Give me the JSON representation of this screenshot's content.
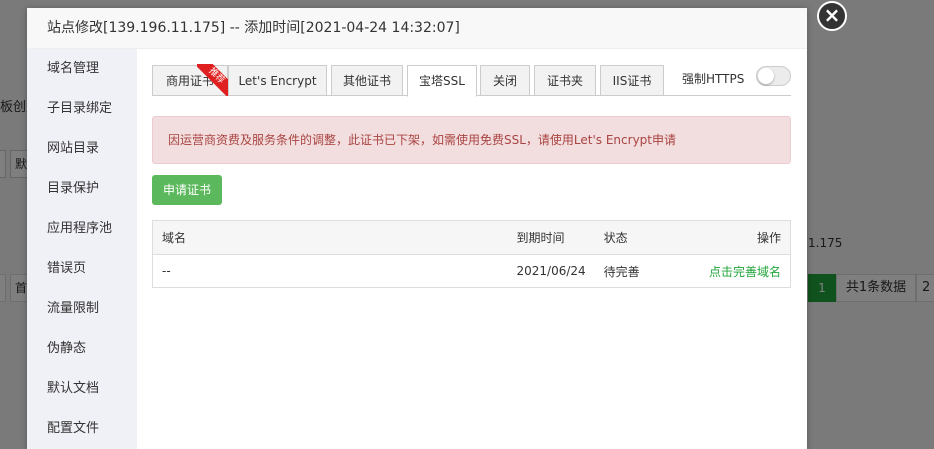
{
  "background": {
    "partial_text_1": "板创建",
    "partial_button": "默",
    "ip_suffix": "1.175",
    "pager_prev_partial": "首",
    "pager_current": "1",
    "pager_total": "共1条数据",
    "pager_next_partial": "2"
  },
  "modal": {
    "title": "站点修改[139.196.11.175] -- 添加时间[2021-04-24 14:32:07]",
    "close_glyph": "×"
  },
  "sidebar": {
    "items": [
      {
        "label": "域名管理"
      },
      {
        "label": "子目录绑定"
      },
      {
        "label": "网站目录"
      },
      {
        "label": "目录保护"
      },
      {
        "label": "应用程序池"
      },
      {
        "label": "错误页"
      },
      {
        "label": "流量限制"
      },
      {
        "label": "伪静态"
      },
      {
        "label": "默认文档"
      },
      {
        "label": "配置文件"
      }
    ]
  },
  "tabs": {
    "items": [
      {
        "label": "商用证书",
        "badge": "推荐"
      },
      {
        "label": "Let's Encrypt"
      },
      {
        "label": "其他证书"
      },
      {
        "label": "宝塔SSL"
      },
      {
        "label": "关闭"
      },
      {
        "label": "证书夹"
      },
      {
        "label": "IIS证书"
      }
    ],
    "active": "宝塔SSL",
    "force_https_label": "强制HTTPS",
    "force_https_on": false
  },
  "alert": {
    "text": "因运营商资费及服务条件的调整，此证书已下架，如需使用免费SSL，请使用Let's Encrypt申请"
  },
  "apply_button": "申请证书",
  "table": {
    "headers": {
      "domain": "域名",
      "expire": "到期时间",
      "status": "状态",
      "action": "操作"
    },
    "rows": [
      {
        "domain": "--",
        "expire": "2021/06/24",
        "status": "待完善",
        "action": "点击完善域名"
      }
    ]
  },
  "colors": {
    "accent_green": "#20a53a",
    "button_green": "#5cb85c",
    "alert_bg": "#f2dede",
    "alert_text": "#a94442",
    "ribbon_red": "#e02020"
  }
}
